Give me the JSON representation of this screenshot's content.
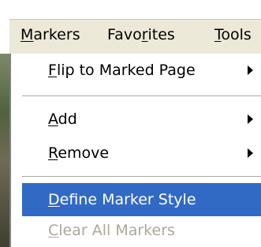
{
  "menubar": {
    "items": [
      {
        "label": "Markers"
      },
      {
        "label": "Favorites"
      },
      {
        "label": "Tools"
      }
    ]
  },
  "markers_menu": {
    "items": [
      {
        "label": "Flip to Marked Page",
        "submenu": true
      },
      {
        "label": "Add",
        "submenu": true
      },
      {
        "label": "Remove",
        "submenu": true
      },
      {
        "label": "Define Marker Style",
        "highlighted": true
      },
      {
        "label": "Clear All Markers",
        "disabled": true
      }
    ]
  },
  "colors": {
    "highlight": "#316ac5",
    "disabled_text": "#aca899",
    "menubar_bg": "#ece9d8"
  }
}
